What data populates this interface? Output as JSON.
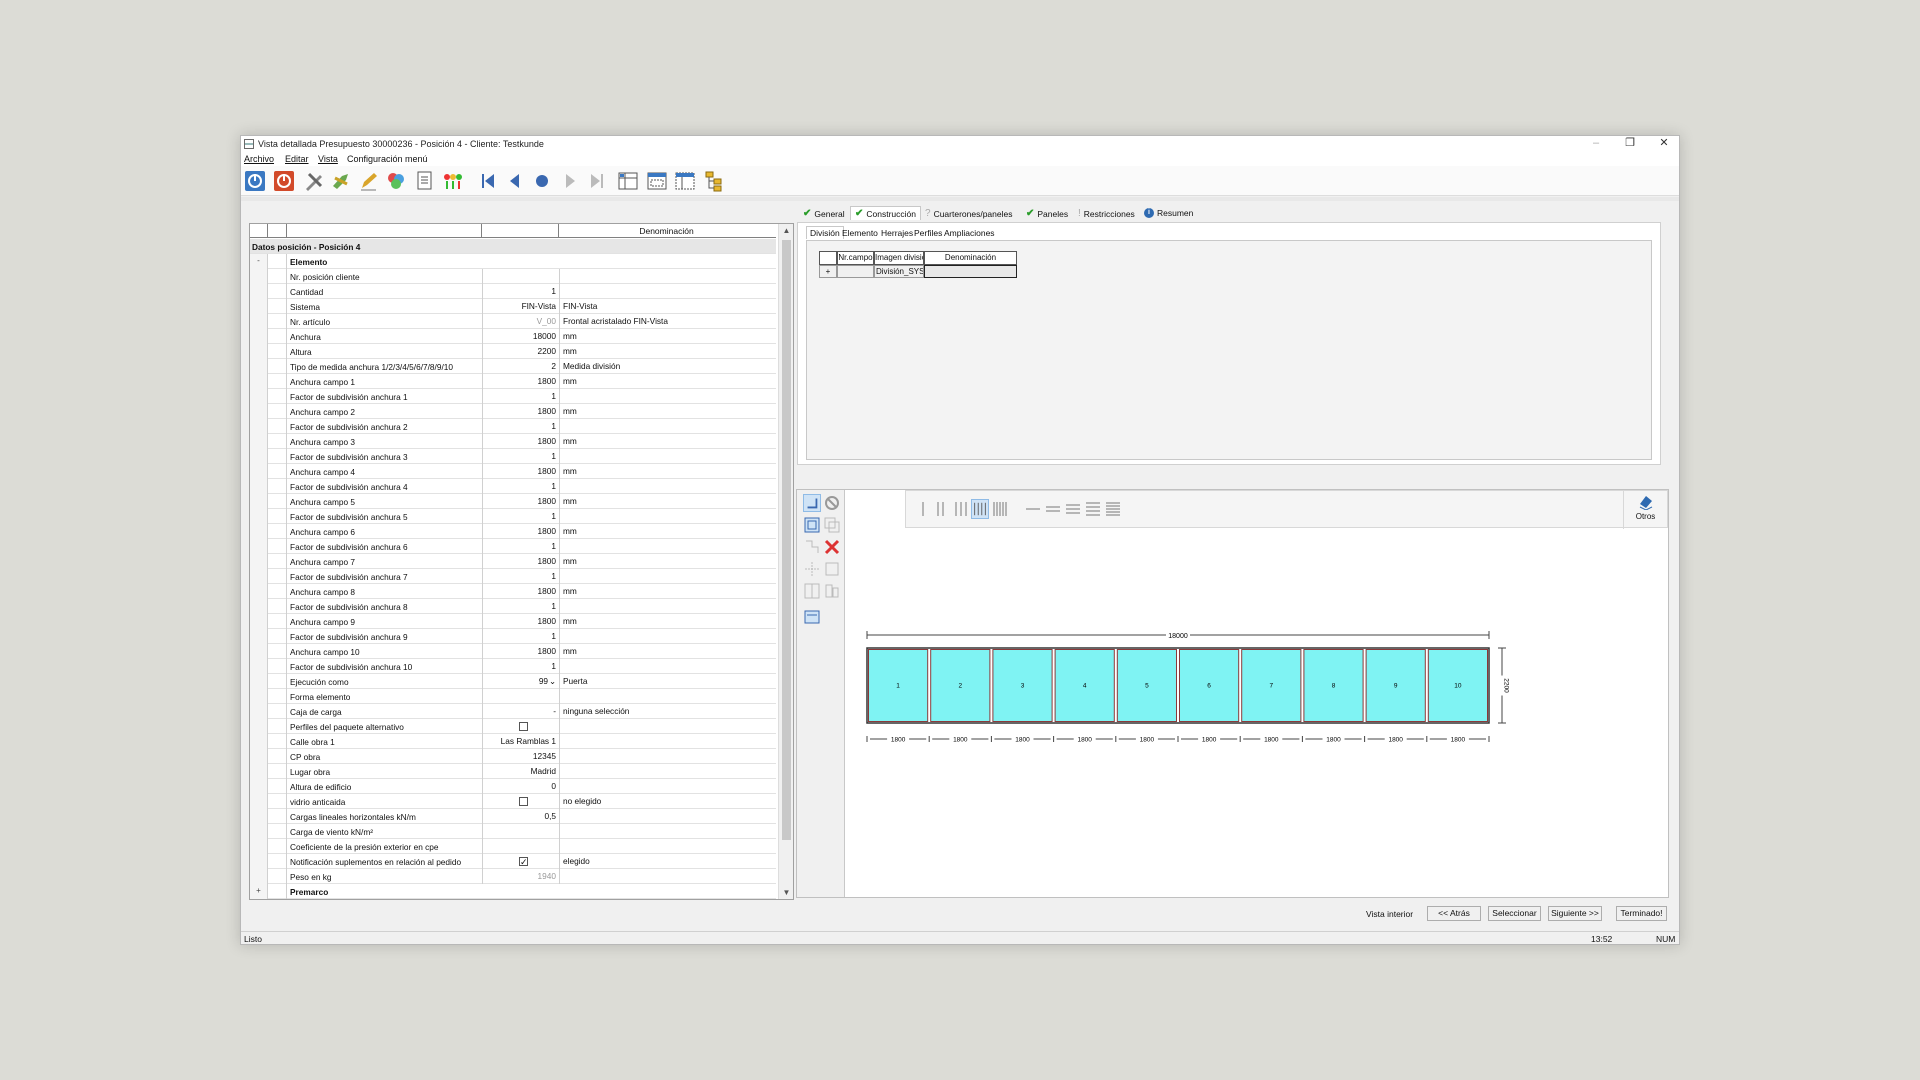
{
  "window": {
    "title": "Vista detallada Presupuesto 30000236 - Posición 4 - Cliente: Testkunde",
    "minimize": "–",
    "restore": "❐",
    "close": "✕"
  },
  "menu": [
    "Archivo",
    "Editar",
    "Vista",
    "Configuración menú"
  ],
  "grid": {
    "header_denominacion": "Denominación",
    "section": "Datos posición - Posición 4",
    "group_elemento": "Elemento",
    "group_premarco": "Premarco",
    "collapse_symbol": "-",
    "expand_symbol": "+",
    "rows": [
      {
        "label": "Nr. posición cliente",
        "value": "",
        "desc": ""
      },
      {
        "label": "Cantidad",
        "value": "1",
        "desc": ""
      },
      {
        "label": "Sistema",
        "value": "FIN-Vista",
        "desc": "FIN-Vista"
      },
      {
        "label": "Nr. artículo",
        "value": "V_00",
        "desc": "Frontal acristalado FIN-Vista"
      },
      {
        "label": "Anchura",
        "value": "18000",
        "desc": "mm"
      },
      {
        "label": "Altura",
        "value": "2200",
        "desc": "mm"
      },
      {
        "label": "Tipo de medida anchura 1/2/3/4/5/6/7/8/9/10",
        "value": "2",
        "desc": "Medida división"
      },
      {
        "label": "Anchura campo 1",
        "value": "1800",
        "desc": "mm"
      },
      {
        "label": "Factor de subdivisión anchura 1",
        "value": "1",
        "desc": ""
      },
      {
        "label": "Anchura campo 2",
        "value": "1800",
        "desc": "mm"
      },
      {
        "label": "Factor de subdivisión anchura 2",
        "value": "1",
        "desc": ""
      },
      {
        "label": "Anchura campo 3",
        "value": "1800",
        "desc": "mm"
      },
      {
        "label": "Factor de subdivisión anchura 3",
        "value": "1",
        "desc": ""
      },
      {
        "label": "Anchura campo 4",
        "value": "1800",
        "desc": "mm"
      },
      {
        "label": "Factor de subdivisión anchura 4",
        "value": "1",
        "desc": ""
      },
      {
        "label": "Anchura campo 5",
        "value": "1800",
        "desc": "mm"
      },
      {
        "label": "Factor de subdivisión anchura 5",
        "value": "1",
        "desc": ""
      },
      {
        "label": "Anchura campo 6",
        "value": "1800",
        "desc": "mm"
      },
      {
        "label": "Factor de subdivisión anchura 6",
        "value": "1",
        "desc": ""
      },
      {
        "label": "Anchura campo 7",
        "value": "1800",
        "desc": "mm"
      },
      {
        "label": "Factor de subdivisión anchura 7",
        "value": "1",
        "desc": ""
      },
      {
        "label": "Anchura campo 8",
        "value": "1800",
        "desc": "mm"
      },
      {
        "label": "Factor de subdivisión anchura 8",
        "value": "1",
        "desc": ""
      },
      {
        "label": "Anchura campo 9",
        "value": "1800",
        "desc": "mm"
      },
      {
        "label": "Factor de subdivisión anchura 9",
        "value": "1",
        "desc": ""
      },
      {
        "label": "Anchura campo 10",
        "value": "1800",
        "desc": "mm"
      },
      {
        "label": "Factor de subdivisión anchura 10",
        "value": "1",
        "desc": ""
      },
      {
        "label": "Ejecución como",
        "value": "99",
        "desc": "Puerta"
      },
      {
        "label": "Forma elemento",
        "value": "",
        "desc": ""
      },
      {
        "label": "Caja de carga",
        "value": "-",
        "desc": "ninguna selección"
      },
      {
        "label": "Perfiles del paquete alternativo",
        "value": "",
        "desc": "",
        "checkbox": false
      },
      {
        "label": "Calle obra 1",
        "value": "Las Ramblas 1",
        "desc": ""
      },
      {
        "label": "CP obra",
        "value": "12345",
        "desc": ""
      },
      {
        "label": "Lugar obra",
        "value": "Madrid",
        "desc": ""
      },
      {
        "label": "Altura de edificio",
        "value": "0",
        "desc": ""
      },
      {
        "label": "vidrio anticaida",
        "value": "",
        "desc": "no elegido",
        "checkbox": false
      },
      {
        "label": "Cargas lineales horizontales kN/m",
        "value": "0,5",
        "desc": ""
      },
      {
        "label": "Carga de viento kN/m²",
        "value": "",
        "desc": ""
      },
      {
        "label": "Coeficiente de la presión exterior en cpe",
        "value": "",
        "desc": ""
      },
      {
        "label": "Notificación suplementos en relación al pedido",
        "value": "",
        "desc": "elegido",
        "checkbox": true
      },
      {
        "label": "Peso en kg",
        "value": "1940",
        "desc": ""
      }
    ]
  },
  "tabs": [
    {
      "label": "General",
      "status": "check"
    },
    {
      "label": "Construcción",
      "status": "check"
    },
    {
      "label": "Cuarterones/paneles",
      "status": "question"
    },
    {
      "label": "Paneles",
      "status": "check"
    },
    {
      "label": "Restricciones",
      "status": "none"
    },
    {
      "label": "Resumen",
      "status": "info"
    }
  ],
  "subtabs": [
    "División",
    "Elemento",
    "Herrajes",
    "Perfiles",
    "Ampliaciones"
  ],
  "division_table": {
    "headers": [
      "Nr.campo",
      "Imagen divisió",
      "Denominación"
    ],
    "row": {
      "expand": "+",
      "nr": "",
      "imagen": "División_SYSTE",
      "den": ""
    }
  },
  "otros_label": "Otros",
  "drawing": {
    "total_width": "18000",
    "height": "2200",
    "field_width": "1800",
    "fields": [
      "1",
      "2",
      "3",
      "4",
      "5",
      "6",
      "7",
      "8",
      "9",
      "10"
    ],
    "glass_color": "#7ff3f3",
    "frame_color": "#8a3a3a"
  },
  "nav": {
    "vista": "Vista interior",
    "back": "<< Atrás",
    "select": "Seleccionar",
    "next": "Siguiente >>",
    "done": "Terminado!"
  },
  "status": {
    "left": "Listo",
    "time": "13:52",
    "num": "NUM"
  }
}
